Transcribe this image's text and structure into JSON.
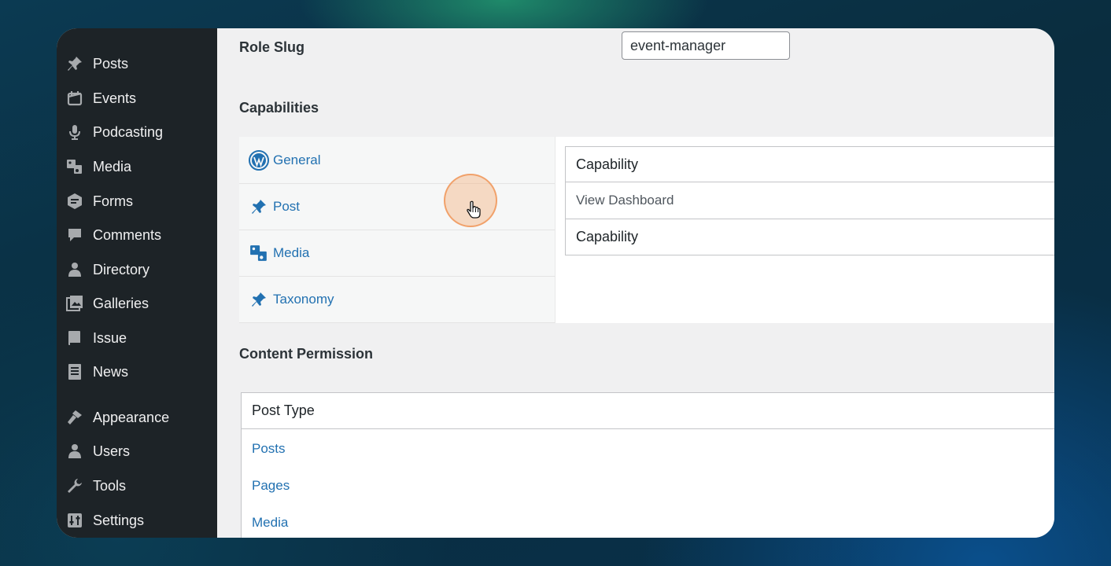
{
  "sidebar": {
    "items": [
      {
        "label": "Posts",
        "icon": "pin-icon"
      },
      {
        "label": "Events",
        "icon": "calendar-icon"
      },
      {
        "label": "Podcasting",
        "icon": "microphone-icon"
      },
      {
        "label": "Media",
        "icon": "media-icon"
      },
      {
        "label": "Forms",
        "icon": "forms-icon"
      },
      {
        "label": "Comments",
        "icon": "comment-icon"
      },
      {
        "label": "Directory",
        "icon": "user-icon"
      },
      {
        "label": "Galleries",
        "icon": "gallery-icon"
      },
      {
        "label": "Issue",
        "icon": "book-icon"
      },
      {
        "label": "News",
        "icon": "document-icon"
      },
      {
        "label": "Appearance",
        "icon": "brush-icon"
      },
      {
        "label": "Users",
        "icon": "user-icon"
      },
      {
        "label": "Tools",
        "icon": "wrench-icon"
      },
      {
        "label": "Settings",
        "icon": "settings-icon"
      }
    ]
  },
  "role_slug": {
    "label": "Role Slug",
    "value": "event-manager"
  },
  "capabilities": {
    "heading": "Capabilities",
    "tabs": [
      {
        "label": "General",
        "icon": "wordpress-icon"
      },
      {
        "label": "Post",
        "icon": "pin-icon"
      },
      {
        "label": "Media",
        "icon": "media-icon"
      },
      {
        "label": "Taxonomy",
        "icon": "pin-icon"
      }
    ],
    "table": {
      "header": "Capability",
      "rows": [
        "View Dashboard"
      ],
      "footer": "Capability"
    }
  },
  "content_permission": {
    "heading": "Content Permission",
    "header": "Post Type",
    "rows": [
      "Posts",
      "Pages",
      "Media"
    ]
  },
  "colors": {
    "sidebar": "#1d2327",
    "link": "#2271b1",
    "page_bg": "#f0f0f1"
  }
}
